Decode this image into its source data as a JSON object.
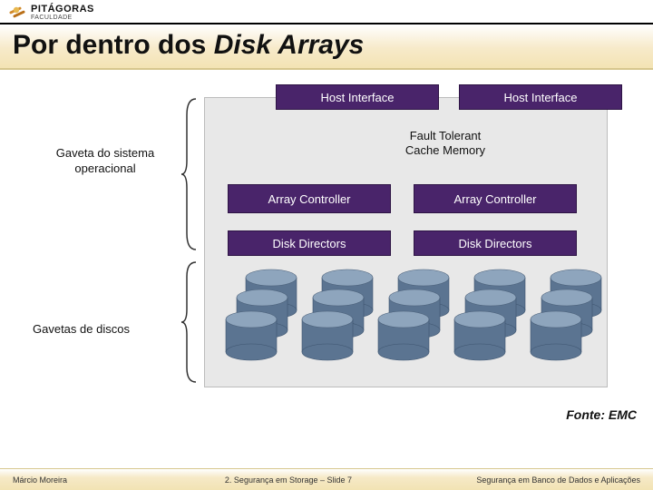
{
  "logo": {
    "name": "PITÁGORAS",
    "sub": "FACULDADE"
  },
  "title": {
    "pre": "Por dentro dos ",
    "italic": "Disk Arrays"
  },
  "diagram": {
    "hostInterface": "Host Interface",
    "faultTolerant": "Fault Tolerant\nCache Memory",
    "arrayController": "Array Controller",
    "diskDirectors": "Disk Directors",
    "osDrawerLabel": "Gaveta do sistema\noperacional",
    "diskDrawerLabel": "Gavetas de discos"
  },
  "source": "Fonte: EMC",
  "footer": {
    "left": "Márcio Moreira",
    "mid": "2. Segurança em Storage – Slide 7",
    "right": "Segurança em Banco de Dados e Aplicações"
  },
  "colors": {
    "accent": "#49246a",
    "diskTop": "#8ea5bd",
    "diskSide": "#5b7491"
  }
}
